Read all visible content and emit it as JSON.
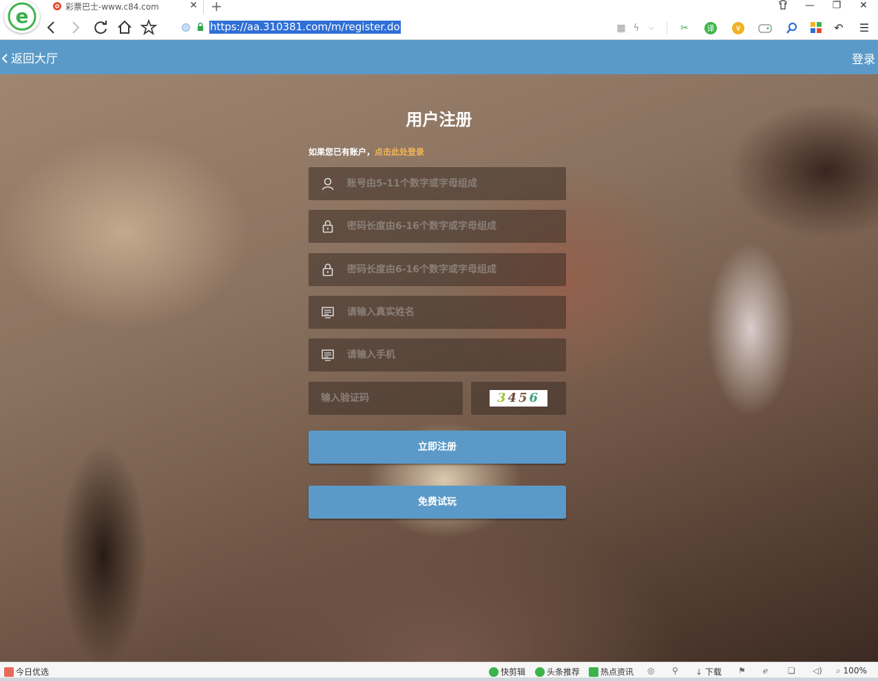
{
  "browser": {
    "tab_title": "彩票巴士-www.c84.com",
    "url": "https://aa.310381.com/m/register.do",
    "icons": [
      "back-icon",
      "forward-icon",
      "reload-icon",
      "home-icon",
      "star-icon",
      "close-icon",
      "new-tab-icon"
    ]
  },
  "header": {
    "back_label": "返回大厅",
    "login_label": "登录",
    "color": "#5b9ac8"
  },
  "form": {
    "title": "用户注册",
    "have_account": "如果您已有账户，",
    "login_here": "点击此处登录",
    "username_placeholder": "账号由5-11个数字或字母组成",
    "password_placeholder": "密码长度由6-16个数字或字母组成",
    "confirm_password_placeholder": "密码长度由6-16个数字或字母组成",
    "realname_placeholder": "请输入真实姓名",
    "phone_placeholder": "请输入手机",
    "captcha_placeholder": "输入验证码",
    "captcha_digits": [
      "3",
      "4",
      "5",
      "6"
    ],
    "register_button": "立即注册",
    "trial_button": "免费试玩"
  },
  "statusbar": {
    "today_pick": "今日优选",
    "quick_cut": "快剪辑",
    "headline": "头条推荐",
    "hot_news": "热点资讯",
    "download": "下载",
    "zoom": "100%"
  }
}
